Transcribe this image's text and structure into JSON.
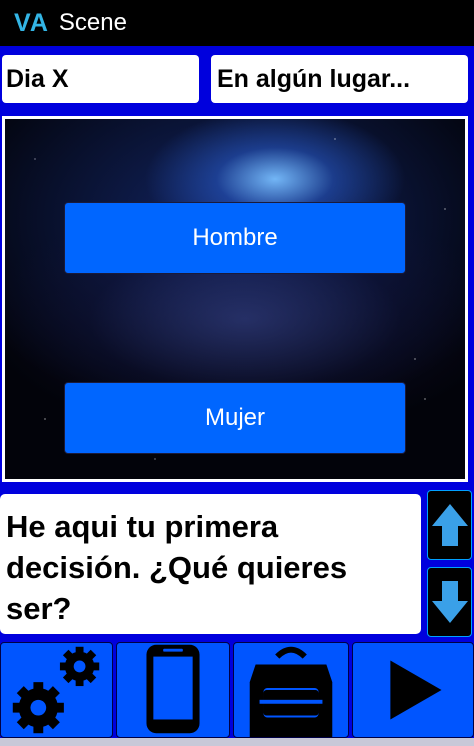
{
  "app": {
    "logo": "VA",
    "title": "Scene"
  },
  "header": {
    "day": "Dia X",
    "place": "En algún lugar..."
  },
  "choices": [
    {
      "label": "Hombre"
    },
    {
      "label": "Mujer"
    }
  ],
  "dialog": {
    "text": "He aqui tu primera decisión. ¿Qué quieres ser?"
  },
  "scroll": {
    "up_icon": "arrow-up-icon",
    "down_icon": "arrow-down-icon"
  },
  "toolbar": {
    "items": [
      {
        "icon": "gears-icon"
      },
      {
        "icon": "phone-icon"
      },
      {
        "icon": "backpack-icon"
      },
      {
        "icon": "play-icon"
      }
    ]
  },
  "colors": {
    "frame": "#0000dd",
    "button": "#0066ff",
    "toolbar": "#0055ff",
    "scroll_arrow": "#3aa0e8",
    "logo": "#33b5e5"
  }
}
